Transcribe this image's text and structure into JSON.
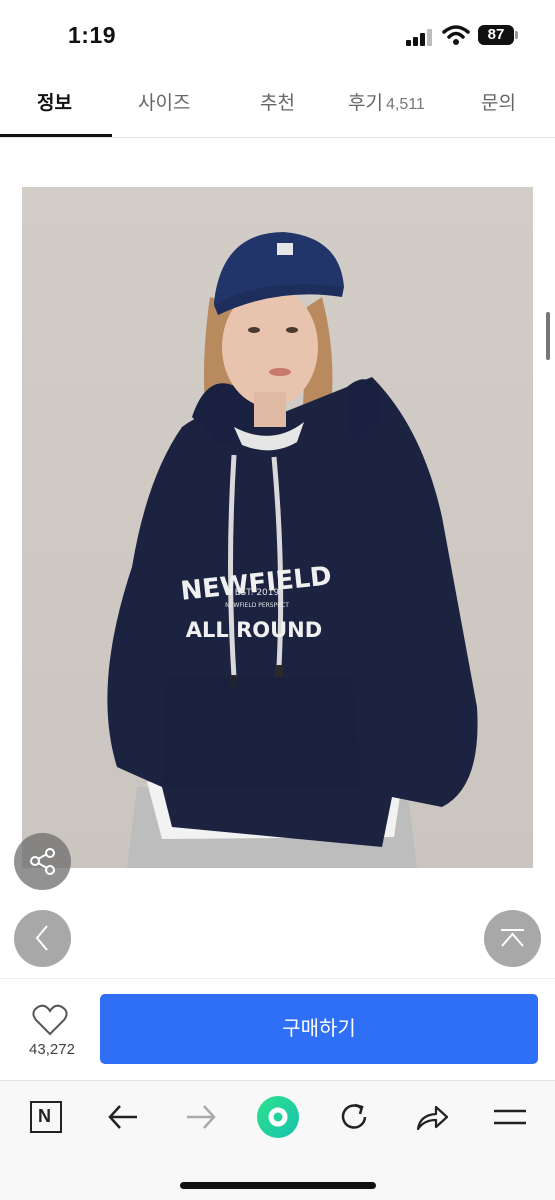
{
  "status_bar": {
    "time": "1:19",
    "battery": "87"
  },
  "tabs": [
    {
      "label": "정보",
      "active": true
    },
    {
      "label": "사이즈",
      "active": false
    },
    {
      "label": "추천",
      "active": false
    },
    {
      "label": "후기",
      "count": "4,511",
      "active": false
    },
    {
      "label": "문의",
      "active": false
    }
  ],
  "product_image": {
    "print_line1": "NEWFIELD",
    "print_line2": "EST. 2019",
    "print_line3": "NEWFIELD PERSPECT",
    "print_line4": "ALL ROUND"
  },
  "purchase": {
    "like_count": "43,272",
    "buy_label": "구매하기",
    "accent_color": "#2f6ff5"
  },
  "browser_toolbar": {
    "icons": [
      "naver-n-icon",
      "back-arrow-icon",
      "forward-arrow-icon",
      "green-dot-home-icon",
      "reload-icon",
      "share-arrow-icon",
      "menu-icon"
    ],
    "n_label": "N"
  }
}
